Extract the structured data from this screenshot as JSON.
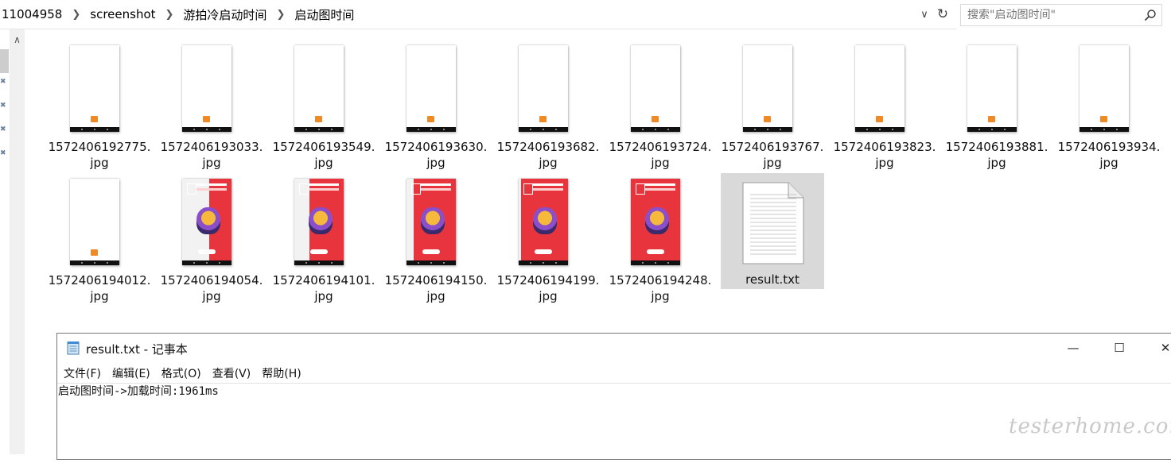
{
  "addressbar": {
    "breadcrumbs": [
      "11004958",
      "screenshot",
      "游拍冷启动时间",
      "启动图时间"
    ],
    "search_placeholder": "搜索\"启动图时间\""
  },
  "files": [
    {
      "name": "1572406192775.jpg",
      "kind": "white",
      "split": 0
    },
    {
      "name": "1572406193033.jpg",
      "kind": "white",
      "split": 0
    },
    {
      "name": "1572406193549.jpg",
      "kind": "white",
      "split": 0
    },
    {
      "name": "1572406193630.jpg",
      "kind": "white",
      "split": 0
    },
    {
      "name": "1572406193682.jpg",
      "kind": "white",
      "split": 0
    },
    {
      "name": "1572406193724.jpg",
      "kind": "white",
      "split": 0
    },
    {
      "name": "1572406193767.jpg",
      "kind": "white",
      "split": 0
    },
    {
      "name": "1572406193823.jpg",
      "kind": "white",
      "split": 0
    },
    {
      "name": "1572406193881.jpg",
      "kind": "white",
      "split": 0
    },
    {
      "name": "1572406193934.jpg",
      "kind": "white",
      "split": 0
    },
    {
      "name": "1572406194012.jpg",
      "kind": "white",
      "split": 0
    },
    {
      "name": "1572406194054.jpg",
      "kind": "red",
      "split": 0.55
    },
    {
      "name": "1572406194101.jpg",
      "kind": "red",
      "split": 0.3
    },
    {
      "name": "1572406194150.jpg",
      "kind": "red",
      "split": 0.15
    },
    {
      "name": "1572406194199.jpg",
      "kind": "red",
      "split": 0.05
    },
    {
      "name": "1572406194248.jpg",
      "kind": "red",
      "split": 0
    },
    {
      "name": "result.txt",
      "kind": "txt",
      "split": 0,
      "selected": true
    }
  ],
  "notepad": {
    "title": "result.txt - 记事本",
    "menu": [
      "文件(F)",
      "编辑(E)",
      "格式(O)",
      "查看(V)",
      "帮助(H)"
    ],
    "content": "启动图时间->加载时间:1961ms",
    "buttons": {
      "minimize": "—",
      "maximize": "☐",
      "close": "✕"
    }
  },
  "icons": {
    "dropdown": "chevron-down-icon",
    "refresh": "refresh-icon",
    "search": "search-icon",
    "pin": "pin-icon"
  },
  "colors": {
    "selected_bg": "#d9d9d9",
    "splash_red": "#e8353d",
    "logo_orange": "#f08a26"
  }
}
